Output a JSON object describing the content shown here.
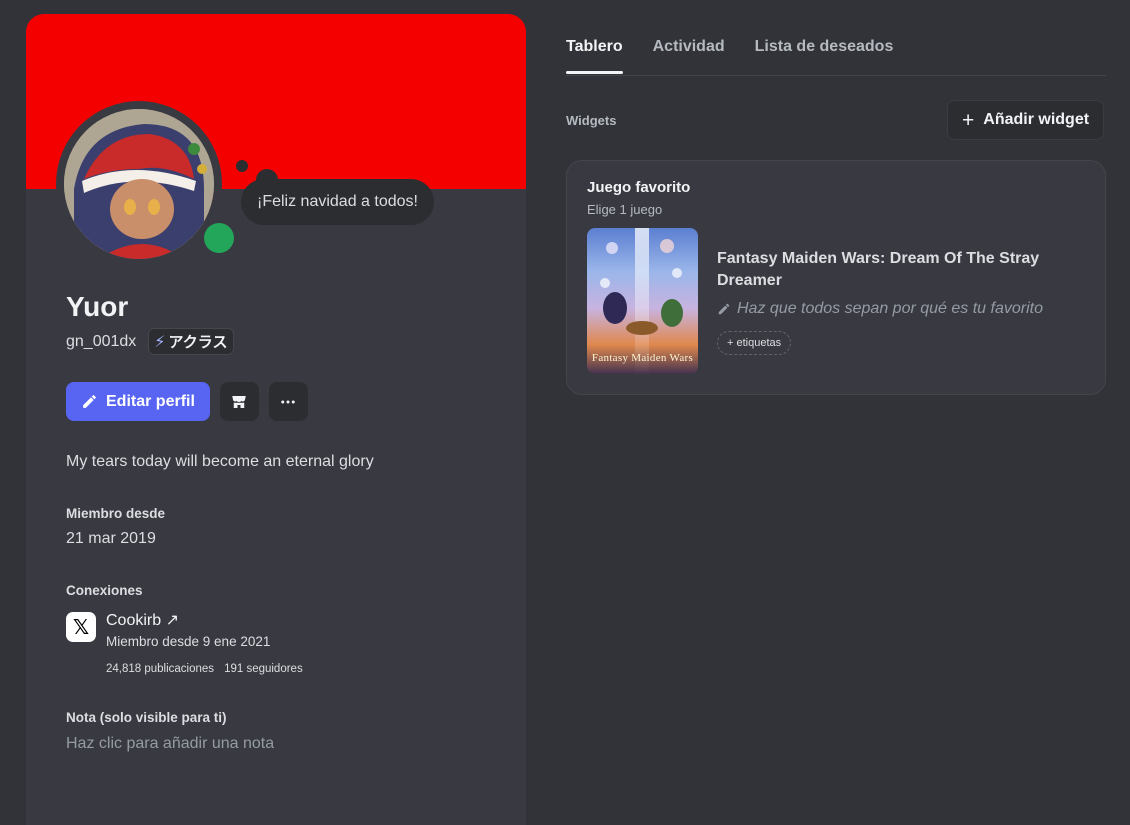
{
  "profile": {
    "status_text": "¡Feliz navidad a todos!",
    "display_name": "Yuor",
    "username": "gn_001dx",
    "clan_tag": "アクラス",
    "edit_button": "Editar perfil",
    "bio": "My tears today will become an eternal glory",
    "member_since_label": "Miembro desde",
    "member_since_value": "21 mar 2019",
    "connections_label": "Conexiones",
    "connection": {
      "name": "Cookirb ↗",
      "since": "Miembro desde 9 ene 2021",
      "posts": "24,818 publicaciones",
      "followers": "191 seguidores"
    },
    "note_label": "Nota (solo visible para ti)",
    "note_placeholder": "Haz clic para añadir una nota"
  },
  "tabs": [
    "Tablero",
    "Actividad",
    "Lista de deseados"
  ],
  "widgets": {
    "label": "Widgets",
    "add_button": "Añadir widget",
    "favorite": {
      "title": "Juego favorito",
      "subtitle": "Elige 1 juego",
      "game_title": "Fantasy Maiden Wars: Dream Of The Stray Dreamer",
      "prompt": "Haz que todos sepan por qué es tu favorito",
      "tags_button": "+ etiquetas",
      "cover_text": "Fantasy Maiden Wars"
    }
  },
  "colors": {
    "banner": "#f50000",
    "accent": "#5865f2",
    "online": "#23a55a"
  },
  "icons": [
    "pencil-icon",
    "shop-icon",
    "more-icon",
    "x-logo-icon",
    "plus-icon",
    "lightning-icon"
  ]
}
